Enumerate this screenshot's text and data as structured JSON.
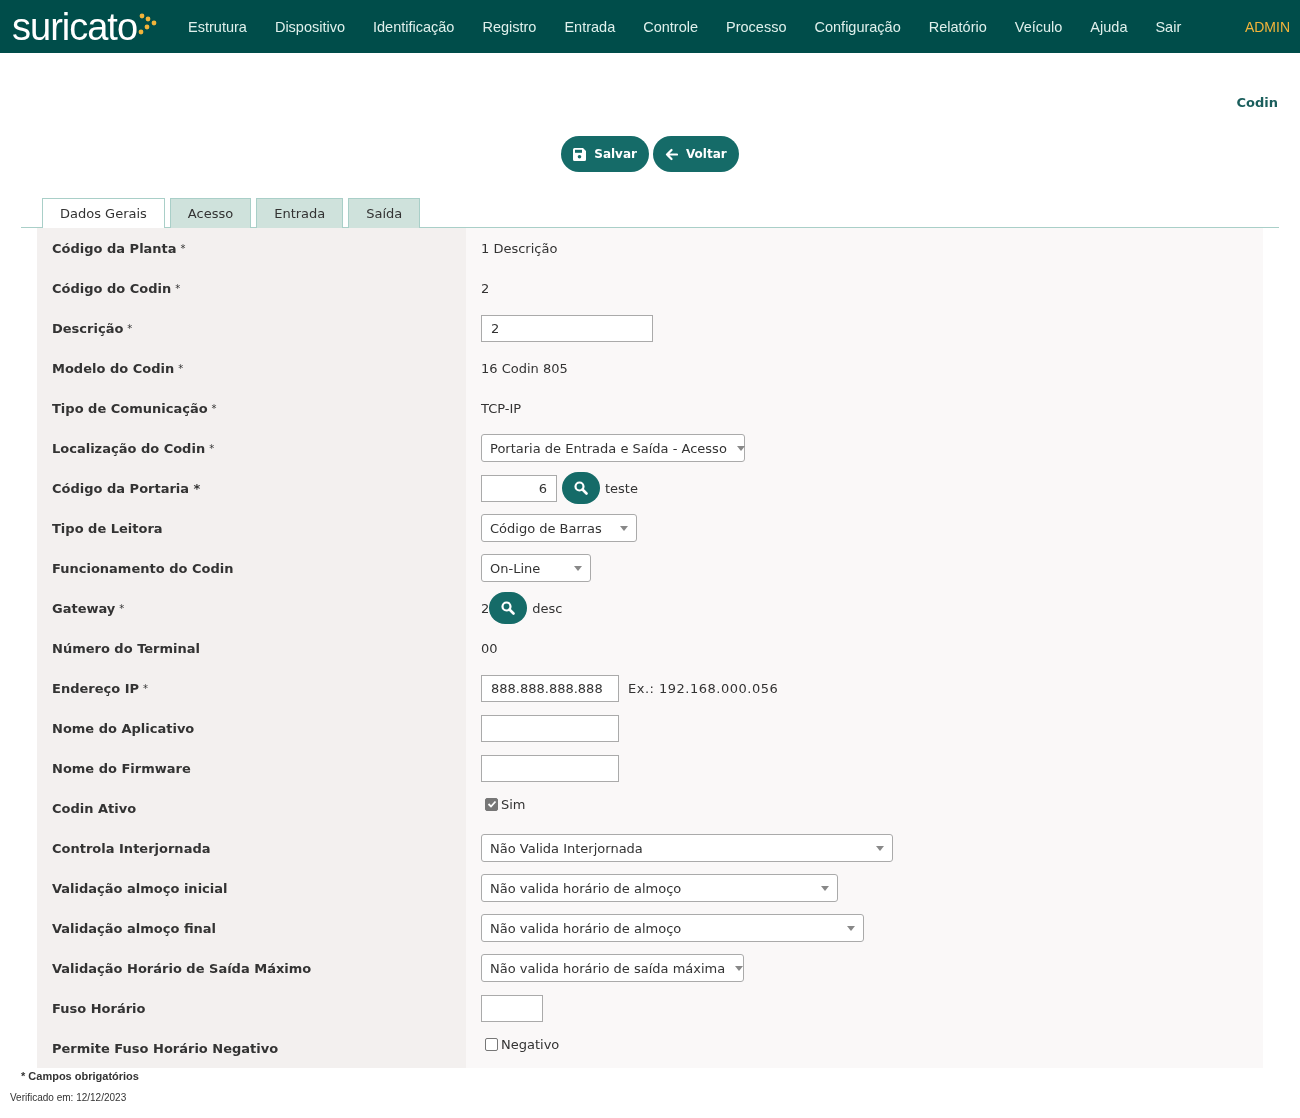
{
  "nav": {
    "logo": "suricato",
    "items": [
      "Estrutura",
      "Dispositivo",
      "Identificação",
      "Registro",
      "Entrada",
      "Controle",
      "Processo",
      "Configuração",
      "Relatório",
      "Veículo",
      "Ajuda",
      "Sair"
    ],
    "user": "ADMIN"
  },
  "page_title": "Codin",
  "actions": [
    {
      "kind": "save",
      "label": "Salvar"
    },
    {
      "kind": "back",
      "label": "Voltar"
    }
  ],
  "tabs": [
    {
      "label": "Dados Gerais",
      "selected": true
    },
    {
      "label": "Acesso",
      "selected": false
    },
    {
      "label": "Entrada",
      "selected": false
    },
    {
      "label": "Saída",
      "selected": false
    }
  ],
  "fields": [
    {
      "label": "Código da Planta",
      "mark": "*",
      "kind": "text",
      "value": "1 Descrição"
    },
    {
      "label": "Código do Codin",
      "mark": "*",
      "kind": "text",
      "value": "2"
    },
    {
      "label": "Descrição",
      "mark": "*",
      "kind": "input",
      "value": "2"
    },
    {
      "label": "Modelo do Codin",
      "mark": "*",
      "kind": "text",
      "value": "16 Codin 805"
    },
    {
      "label": "Tipo de Comunicação",
      "mark": "*",
      "kind": "text",
      "value": "TCP-IP"
    },
    {
      "label": "Localização do Codin",
      "mark": "*",
      "kind": "select",
      "value": "Portaria de Entrada e Saída - Acesso"
    },
    {
      "label": "Código da Portaria *",
      "kind": "lookup",
      "value": "6",
      "description": "teste"
    },
    {
      "label": "Tipo de Leitora",
      "kind": "select",
      "value": "Código de Barras"
    },
    {
      "label": "Funcionamento do Codin",
      "kind": "select",
      "value": "On-Line"
    },
    {
      "label": "Gateway",
      "mark": "*",
      "kind": "lookup_text",
      "value": "2",
      "description": "desc"
    },
    {
      "label": "Número do Terminal",
      "kind": "text",
      "value": "00"
    },
    {
      "label": "Endereço IP",
      "mark": "*",
      "kind": "input",
      "value": "888.888.888.888",
      "hint": "Ex.: 192.168.000.056"
    },
    {
      "label": "Nome do Aplicativo",
      "kind": "input"
    },
    {
      "label": "Nome do Firmware",
      "kind": "input"
    },
    {
      "label": "Codin Ativo",
      "kind": "checkbox",
      "checked": true,
      "option": "Sim"
    },
    {
      "label": "Controla Interjornada",
      "kind": "select",
      "value": "Não Valida Interjornada"
    },
    {
      "label": "Validação almoço inicial",
      "kind": "select",
      "value": "Não valida horário de almoço"
    },
    {
      "label": "Validação almoço final",
      "kind": "select",
      "value": "Não valida horário de almoço"
    },
    {
      "label": "Validação Horário de Saída Máximo",
      "kind": "select",
      "value": "Não valida horário de saída máxima"
    },
    {
      "label": "Fuso Horário",
      "kind": "input"
    },
    {
      "label": "Permite Fuso Horário Negativo",
      "kind": "checkbox",
      "checked": false,
      "option": "Negativo"
    }
  ],
  "footnote": "* Campos obrigatórios",
  "verified": "Verificado em: 12/12/2023"
}
